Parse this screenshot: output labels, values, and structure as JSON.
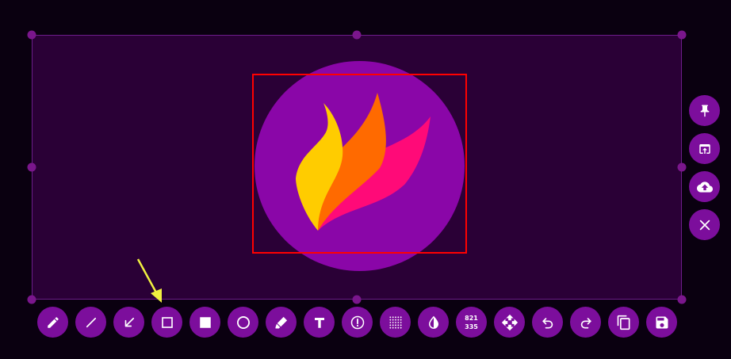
{
  "screen": "screenshot-editor",
  "colors": {
    "background": "#0a0010",
    "selection_fill": "#2a0036",
    "selection_border": "#6c1d8a",
    "button": "#7c0e9c",
    "logo_circle": "#8a06a8",
    "annotation_rect": "#ff0000",
    "pointer_arrow": "#f0f040"
  },
  "side_toolbar": [
    {
      "icon": "pin-icon"
    },
    {
      "icon": "open-with-app-icon"
    },
    {
      "icon": "cloud-upload-icon"
    },
    {
      "icon": "close-icon"
    }
  ],
  "bottom_toolbar": [
    {
      "icon": "pencil-icon"
    },
    {
      "icon": "line-icon"
    },
    {
      "icon": "arrow-icon"
    },
    {
      "icon": "rectangle-outline-icon"
    },
    {
      "icon": "rectangle-filled-icon"
    },
    {
      "icon": "circle-icon"
    },
    {
      "icon": "marker-icon"
    },
    {
      "icon": "text-icon"
    },
    {
      "icon": "exclamation-circle-icon"
    },
    {
      "icon": "pixelate-icon"
    },
    {
      "icon": "invert-icon"
    },
    {
      "icon": "selection-size-counter"
    },
    {
      "icon": "move-icon"
    },
    {
      "icon": "undo-icon"
    },
    {
      "icon": "redo-icon"
    },
    {
      "icon": "copy-icon"
    },
    {
      "icon": "save-icon"
    }
  ],
  "selection_size": {
    "width": "821",
    "height": "335"
  }
}
